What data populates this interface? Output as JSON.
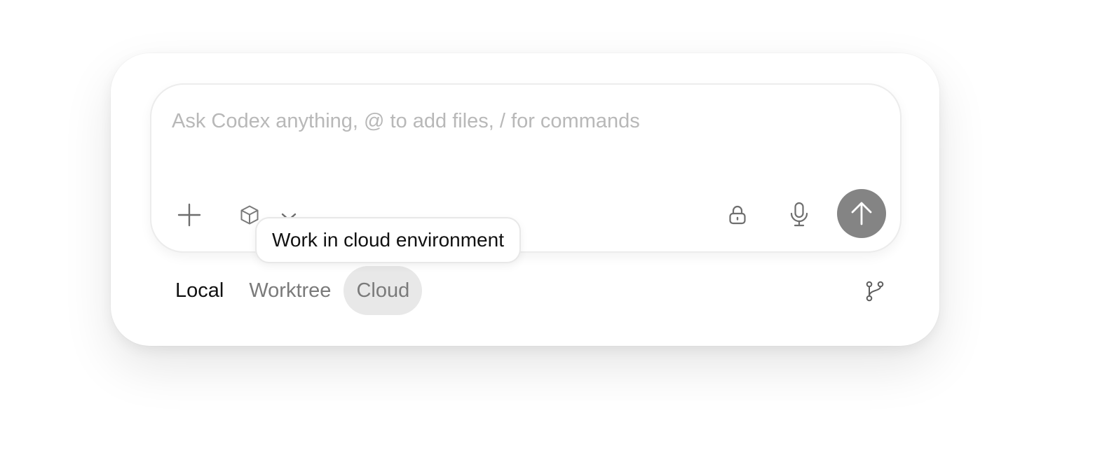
{
  "composer": {
    "placeholder": "Ask Codex anything, @ to add files, / for commands",
    "value": ""
  },
  "toolbar": {
    "add_icon": "plus-icon",
    "environment_icon": "cube-icon",
    "environment_dropdown_icon": "chevron-down-icon",
    "permissions_icon": "lock-icon",
    "voice_icon": "microphone-icon",
    "send_icon": "arrow-up-icon"
  },
  "tooltip": {
    "text": "Work in cloud environment"
  },
  "modes": {
    "items": [
      {
        "label": "Local"
      },
      {
        "label": "Worktree"
      },
      {
        "label": "Cloud"
      }
    ],
    "selected": "Cloud"
  },
  "branch": {
    "icon": "git-branch-icon"
  },
  "colors": {
    "send_button_bg": "#848484",
    "selected_tab_bg": "#e8e8e8",
    "placeholder": "#b8b8b8"
  }
}
